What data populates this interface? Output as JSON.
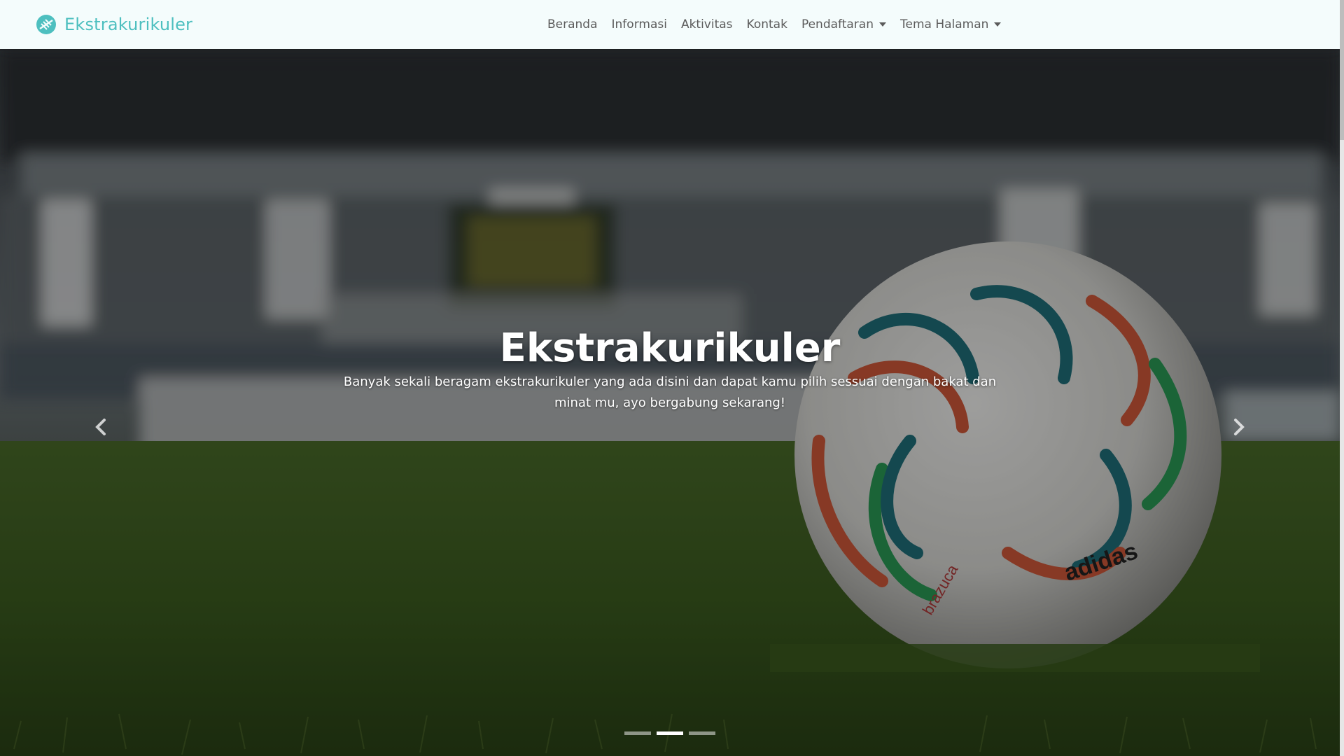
{
  "navbar": {
    "brand": "Ekstrakurikuler",
    "brand_icon": "football-icon",
    "brand_color": "#4dbfbf",
    "items": [
      {
        "label": "Beranda"
      },
      {
        "label": "Informasi"
      },
      {
        "label": "Aktivitas"
      },
      {
        "label": "Kontak"
      },
      {
        "label": "Pendaftaran",
        "dropdown": true
      },
      {
        "label": "Tema Halaman",
        "dropdown": true
      }
    ]
  },
  "hero": {
    "title": "Ekstrakurikuler",
    "text": "Banyak sekali beragam ekstrakurikuler yang ada disini dan dapat kamu pilih sessuai dengan bakat dan minat mu, ayo bergabung sekarang!",
    "ball_brand": "adidas",
    "ball_model": "brazuca",
    "prev_icon": "chevron-left-icon",
    "next_icon": "chevron-right-icon",
    "slides": 3,
    "active_slide": 2
  }
}
